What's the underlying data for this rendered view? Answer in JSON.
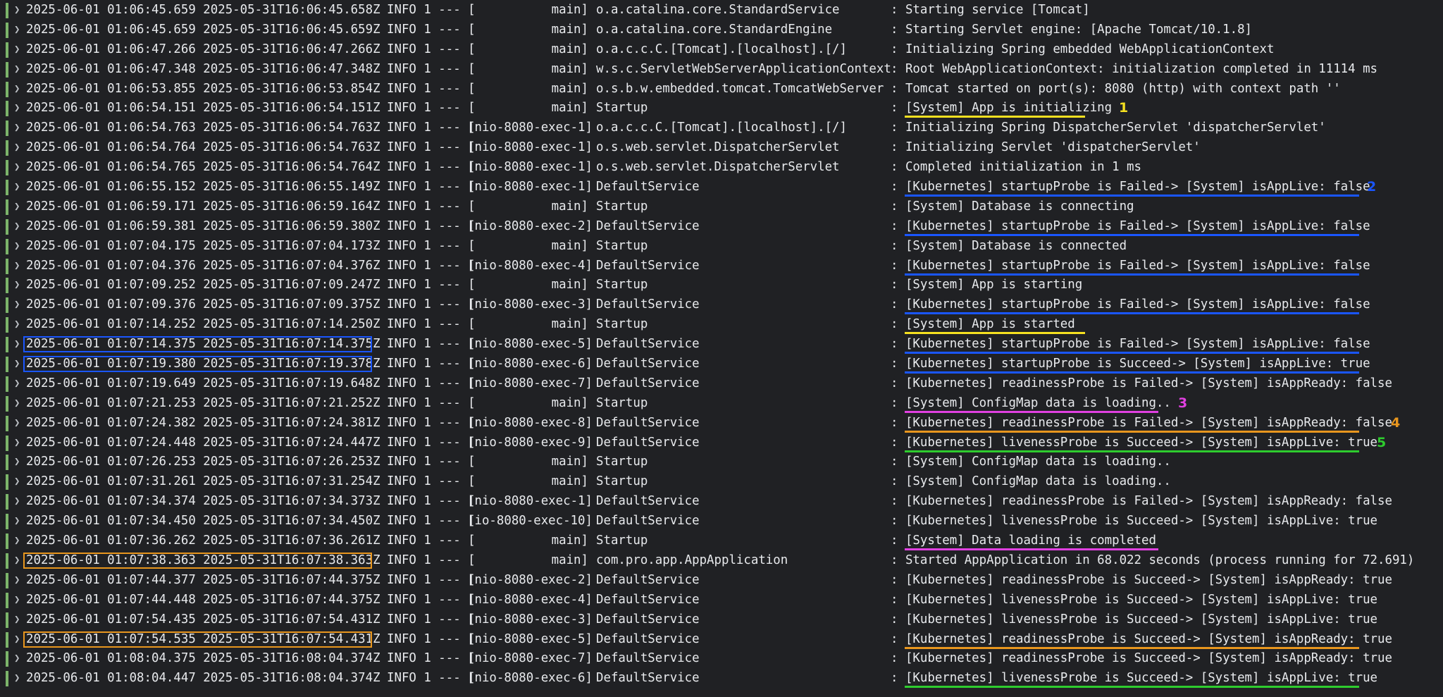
{
  "colors": {
    "background": "#202124",
    "text": "#e8eaed",
    "gutter": "#7cb46a",
    "blue": "#1a56ff",
    "yellow": "#f5e020",
    "magenta": "#e040e0",
    "orange": "#e8961e",
    "green": "#2ecc2e"
  },
  "log": {
    "meta_text": "INFO 1 --- [",
    "separator": ":",
    "rows": [
      {
        "ts": "2025-06-01 01:06:45.659 2025-05-31T16:06:45.658Z",
        "thread": "main]",
        "logger": "o.a.catalina.core.StandardService",
        "sep": " ",
        "message": ": Starting service [Tomcat]"
      },
      {
        "ts": "2025-06-01 01:06:45.659 2025-05-31T16:06:45.659Z",
        "thread": "main]",
        "logger": "o.a.catalina.core.StandardEngine",
        "message": ": Starting Servlet engine: [Apache Tomcat/10.1.8]"
      },
      {
        "ts": "2025-06-01 01:06:47.266 2025-05-31T16:06:47.266Z",
        "thread": "main]",
        "logger": "o.a.c.c.C.[Tomcat].[localhost].[/]",
        "message": ": Initializing Spring embedded WebApplicationContext"
      },
      {
        "ts": "2025-06-01 01:06:47.348 2025-05-31T16:06:47.348Z",
        "thread": "main]",
        "logger": "w.s.c.ServletWebServerApplicationContext",
        "message": ": Root WebApplicationContext: initialization completed in 11114 ms"
      },
      {
        "ts": "2025-06-01 01:06:53.855 2025-05-31T16:06:53.854Z",
        "thread": "main]",
        "logger": "o.s.b.w.embedded.tomcat.TomcatWebServer",
        "message": ": Tomcat started on port(s): 8080 (http) with context path ''"
      },
      {
        "ts": "2025-06-01 01:06:54.151 2025-05-31T16:06:54.151Z",
        "thread": "main]",
        "logger": "Startup",
        "message": ": [System] App is initializing",
        "underline": "yellow",
        "mark": "1",
        "mark_color": "yellow"
      },
      {
        "ts": "2025-06-01 01:06:54.763 2025-05-31T16:06:54.763Z",
        "thread": "[nio-8080-exec-1]",
        "logger": "o.a.c.c.C.[Tomcat].[localhost].[/]",
        "message": ": Initializing Spring DispatcherServlet 'dispatcherServlet'"
      },
      {
        "ts": "2025-06-01 01:06:54.764 2025-05-31T16:06:54.763Z",
        "thread": "[nio-8080-exec-1]",
        "logger": "o.s.web.servlet.DispatcherServlet",
        "message": ": Initializing Servlet 'dispatcherServlet'"
      },
      {
        "ts": "2025-06-01 01:06:54.765 2025-05-31T16:06:54.764Z",
        "thread": "[nio-8080-exec-1]",
        "logger": "o.s.web.servlet.DispatcherServlet",
        "message": ": Completed initialization in 1 ms"
      },
      {
        "ts": "2025-06-01 01:06:55.152 2025-05-31T16:06:55.149Z",
        "thread": "[nio-8080-exec-1]",
        "logger": "DefaultService",
        "message": ": [Kubernetes] startupProbe is Failed-> [System] isAppLive: false",
        "underline": "blue",
        "mark": "2",
        "mark_color": "blue"
      },
      {
        "ts": "2025-06-01 01:06:59.171 2025-05-31T16:06:59.164Z",
        "thread": "main]",
        "logger": "Startup",
        "message": ": [System] Database is connecting"
      },
      {
        "ts": "2025-06-01 01:06:59.381 2025-05-31T16:06:59.380Z",
        "thread": "[nio-8080-exec-2]",
        "logger": "DefaultService",
        "message": ": [Kubernetes] startupProbe is Failed-> [System] isAppLive: false",
        "underline": "blue"
      },
      {
        "ts": "2025-06-01 01:07:04.175 2025-05-31T16:07:04.173Z",
        "thread": "main]",
        "logger": "Startup",
        "message": ": [System] Database is connected"
      },
      {
        "ts": "2025-06-01 01:07:04.376 2025-05-31T16:07:04.376Z",
        "thread": "[nio-8080-exec-4]",
        "logger": "DefaultService",
        "message": ": [Kubernetes] startupProbe is Failed-> [System] isAppLive: false",
        "underline": "blue"
      },
      {
        "ts": "2025-06-01 01:07:09.252 2025-05-31T16:07:09.247Z",
        "thread": "main]",
        "logger": "Startup",
        "message": ": [System] App is starting"
      },
      {
        "ts": "2025-06-01 01:07:09.376 2025-05-31T16:07:09.375Z",
        "thread": "[nio-8080-exec-3]",
        "logger": "DefaultService",
        "message": ": [Kubernetes] startupProbe is Failed-> [System] isAppLive: false",
        "underline": "blue"
      },
      {
        "ts": "2025-06-01 01:07:14.252 2025-05-31T16:07:14.250Z",
        "thread": "main]",
        "logger": "Startup",
        "message": ": [System] App is started",
        "underline": "yellow"
      },
      {
        "ts": "2025-06-01 01:07:14.375 2025-05-31T16:07:14.375Z",
        "thread": "[nio-8080-exec-5]",
        "logger": "DefaultService",
        "message": ": [Kubernetes] startupProbe is Failed-> [System] isAppLive: false",
        "underline": "blue",
        "box": "blue"
      },
      {
        "ts": "2025-06-01 01:07:19.380 2025-05-31T16:07:19.378Z",
        "thread": "[nio-8080-exec-6]",
        "logger": "DefaultService",
        "message": ": [Kubernetes] startupProbe is Succeed-> [System] isAppLive: true",
        "underline": "blue",
        "box": "blue"
      },
      {
        "ts": "2025-06-01 01:07:19.649 2025-05-31T16:07:19.648Z",
        "thread": "[nio-8080-exec-7]",
        "logger": "DefaultService",
        "message": ": [Kubernetes] readinessProbe is Failed-> [System] isAppReady: false"
      },
      {
        "ts": "2025-06-01 01:07:21.253 2025-05-31T16:07:21.252Z",
        "thread": "main]",
        "logger": "Startup",
        "message": ": [System] ConfigMap data is loading..",
        "underline": "magenta",
        "mark": "3",
        "mark_color": "magenta"
      },
      {
        "ts": "2025-06-01 01:07:24.382 2025-05-31T16:07:24.381Z",
        "thread": "[nio-8080-exec-8]",
        "logger": "DefaultService",
        "message": ": [Kubernetes] readinessProbe is Failed-> [System] isAppReady: false",
        "underline": "orange",
        "mark": "4",
        "mark_color": "orange"
      },
      {
        "ts": "2025-06-01 01:07:24.448 2025-05-31T16:07:24.447Z",
        "thread": "[nio-8080-exec-9]",
        "logger": "DefaultService",
        "message": ": [Kubernetes] livenessProbe is Succeed-> [System] isAppLive: true",
        "underline": "green",
        "mark": "5",
        "mark_color": "green"
      },
      {
        "ts": "2025-06-01 01:07:26.253 2025-05-31T16:07:26.253Z",
        "thread": "main]",
        "logger": "Startup",
        "message": ": [System] ConfigMap data is loading.."
      },
      {
        "ts": "2025-06-01 01:07:31.261 2025-05-31T16:07:31.254Z",
        "thread": "main]",
        "logger": "Startup",
        "message": ": [System] ConfigMap data is loading.."
      },
      {
        "ts": "2025-06-01 01:07:34.374 2025-05-31T16:07:34.373Z",
        "thread": "[nio-8080-exec-1]",
        "logger": "DefaultService",
        "message": ": [Kubernetes] readinessProbe is Failed-> [System] isAppReady: false"
      },
      {
        "ts": "2025-06-01 01:07:34.450 2025-05-31T16:07:34.450Z",
        "thread": "[io-8080-exec-10]",
        "logger": "DefaultService",
        "message": ": [Kubernetes] livenessProbe is Succeed-> [System] isAppLive: true"
      },
      {
        "ts": "2025-06-01 01:07:36.262 2025-05-31T16:07:36.261Z",
        "thread": "main]",
        "logger": "Startup",
        "message": ": [System] Data loading is completed",
        "underline": "magenta"
      },
      {
        "ts": "2025-06-01 01:07:38.363 2025-05-31T16:07:38.363Z",
        "thread": "main]",
        "logger": "com.pro.app.AppApplication",
        "message": ": Started AppApplication in 68.022 seconds (process running for 72.691)",
        "box": "orange"
      },
      {
        "ts": "2025-06-01 01:07:44.377 2025-05-31T16:07:44.375Z",
        "thread": "[nio-8080-exec-2]",
        "logger": "DefaultService",
        "message": ": [Kubernetes] readinessProbe is Succeed-> [System] isAppReady: true"
      },
      {
        "ts": "2025-06-01 01:07:44.448 2025-05-31T16:07:44.375Z",
        "thread": "[nio-8080-exec-4]",
        "logger": "DefaultService",
        "message": ": [Kubernetes] livenessProbe is Succeed-> [System] isAppLive: true"
      },
      {
        "ts": "2025-06-01 01:07:54.435 2025-05-31T16:07:54.431Z",
        "thread": "[nio-8080-exec-3]",
        "logger": "DefaultService",
        "message": ": [Kubernetes] livenessProbe is Succeed-> [System] isAppLive: true"
      },
      {
        "ts": "2025-06-01 01:07:54.535 2025-05-31T16:07:54.431Z",
        "thread": "[nio-8080-exec-5]",
        "logger": "DefaultService",
        "message": ": [Kubernetes] readinessProbe is Succeed-> [System] isAppReady: true",
        "underline": "orange",
        "box": "orange"
      },
      {
        "ts": "2025-06-01 01:08:04.375 2025-05-31T16:08:04.374Z",
        "thread": "[nio-8080-exec-7]",
        "logger": "DefaultService",
        "message": ": [Kubernetes] readinessProbe is Succeed-> [System] isAppReady: true"
      },
      {
        "ts": "2025-06-01 01:08:04.447 2025-05-31T16:08:04.374Z",
        "thread": "[nio-8080-exec-6]",
        "logger": "DefaultService",
        "message": ": [Kubernetes] livenessProbe is Succeed-> [System] isAppLive: true",
        "underline": "green"
      }
    ]
  }
}
